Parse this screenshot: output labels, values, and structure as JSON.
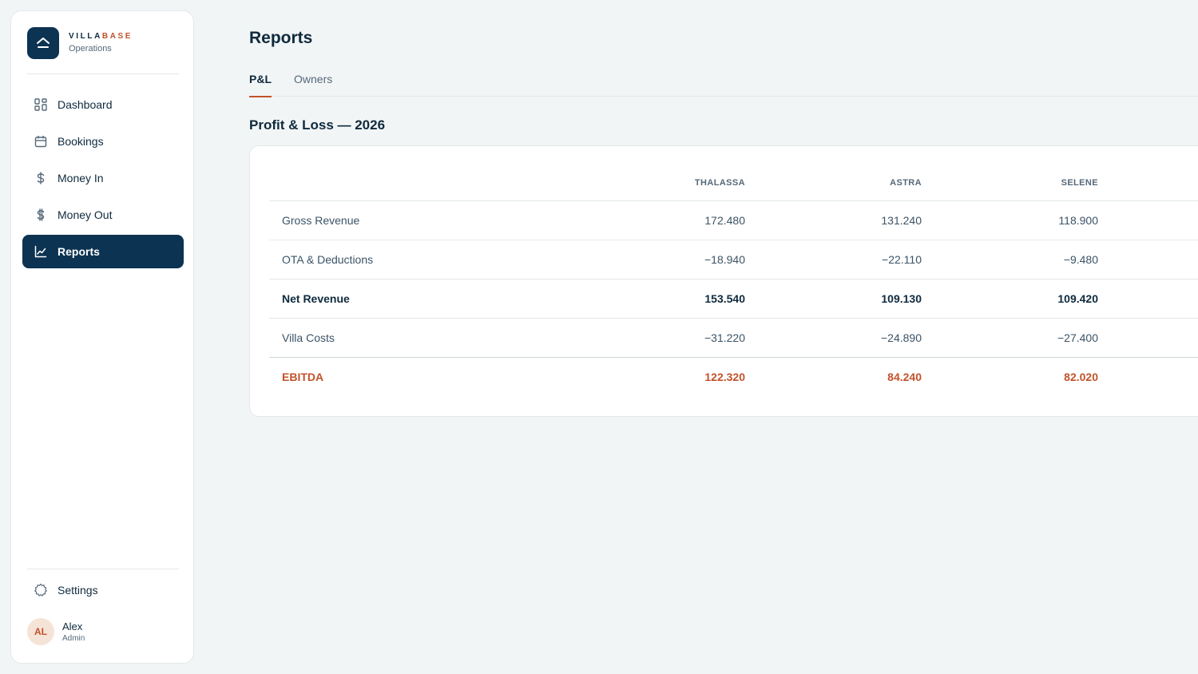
{
  "app": {
    "brand_part1": "VILLA",
    "brand_part2": "BASE",
    "subtitle": "Operations",
    "logo_icon": "home-roof-icon"
  },
  "sidebar": {
    "items": [
      {
        "label": "Dashboard",
        "icon": "grid-icon",
        "active": false
      },
      {
        "label": "Bookings",
        "icon": "calendar-icon",
        "active": false
      },
      {
        "label": "Money In",
        "icon": "dollar-icon",
        "active": false
      },
      {
        "label": "Money Out",
        "icon": "dollar-out-icon",
        "active": false
      },
      {
        "label": "Reports",
        "icon": "chart-line-icon",
        "active": true
      }
    ],
    "settings_label": "Settings",
    "user": {
      "initials": "AL",
      "name": "Alex",
      "role": "Admin"
    }
  },
  "main": {
    "title": "Reports",
    "tabs": [
      {
        "label": "P&L",
        "active": true
      },
      {
        "label": "Owners",
        "active": false
      }
    ],
    "section_title": "Profit & Loss — 2026",
    "table": {
      "columns": [
        "",
        "THALASSA",
        "ASTRA",
        "SELENE"
      ],
      "rows": [
        {
          "label": "Gross Revenue",
          "values": [
            "172.480",
            "131.240",
            "118.900"
          ],
          "style": "normal"
        },
        {
          "label": "OTA & Deductions",
          "values": [
            "−18.940",
            "−22.110",
            "−9.480"
          ],
          "style": "normal"
        },
        {
          "label": "Net Revenue",
          "values": [
            "153.540",
            "109.130",
            "109.420"
          ],
          "style": "strong"
        },
        {
          "label": "Villa Costs",
          "values": [
            "−31.220",
            "−24.890",
            "−27.400"
          ],
          "style": "normal"
        },
        {
          "label": "EBITDA",
          "values": [
            "122.320",
            "84.240",
            "82.020"
          ],
          "style": "total"
        }
      ]
    }
  },
  "colors": {
    "primary": "#0d3352",
    "accent": "#c2522a",
    "background": "#f2f5f6"
  }
}
